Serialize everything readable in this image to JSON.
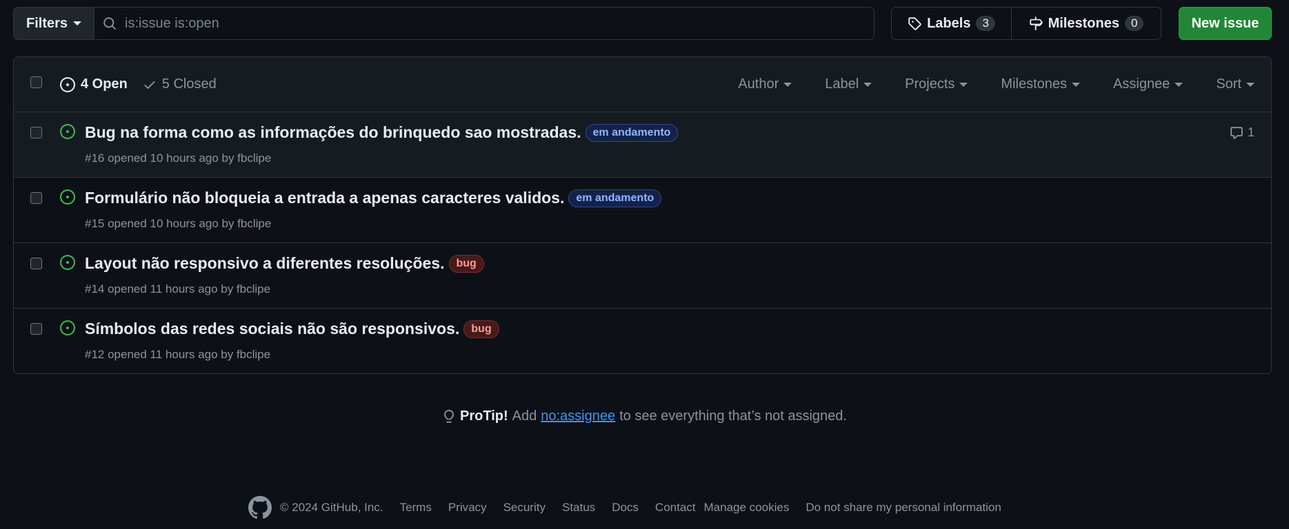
{
  "toolbar": {
    "filters_label": "Filters",
    "search_value": "is:issue is:open",
    "labels_label": "Labels",
    "labels_count": "3",
    "milestones_label": "Milestones",
    "milestones_count": "0",
    "new_issue_label": "New issue"
  },
  "header": {
    "open_label": "4 Open",
    "closed_label": "5 Closed",
    "filters": [
      "Author",
      "Label",
      "Projects",
      "Milestones",
      "Assignee",
      "Sort"
    ]
  },
  "issues": [
    {
      "title": "Bug na forma como as informações do brinquedo sao mostradas.",
      "label": "em andamento",
      "label_color": "blue",
      "meta": "#16 opened 10 hours ago by fbclipe",
      "comments": "1"
    },
    {
      "title": "Formulário não bloqueia a entrada a apenas caracteres validos.",
      "label": "em andamento",
      "label_color": "blue",
      "meta": "#15 opened 10 hours ago by fbclipe",
      "comments": ""
    },
    {
      "title": "Layout não responsivo a diferentes resoluções.",
      "label": "bug",
      "label_color": "red",
      "meta": "#14 opened 11 hours ago by fbclipe",
      "comments": ""
    },
    {
      "title": "Símbolos das redes sociais não são responsivos.",
      "label": "bug",
      "label_color": "red",
      "meta": "#12 opened 11 hours ago by fbclipe",
      "comments": ""
    }
  ],
  "protip": {
    "heading": "ProTip!",
    "before": "Add",
    "link": "no:assignee",
    "after": "to see everything that’s not assigned."
  },
  "footer": {
    "copyright": "© 2024 GitHub, Inc.",
    "links": [
      "Terms",
      "Privacy",
      "Security",
      "Status",
      "Docs",
      "Contact",
      "Manage cookies",
      "Do not share my personal information"
    ]
  },
  "colors": {
    "accent_green": "#3fb950",
    "link_blue": "#4493f8",
    "button_green": "#238636"
  }
}
